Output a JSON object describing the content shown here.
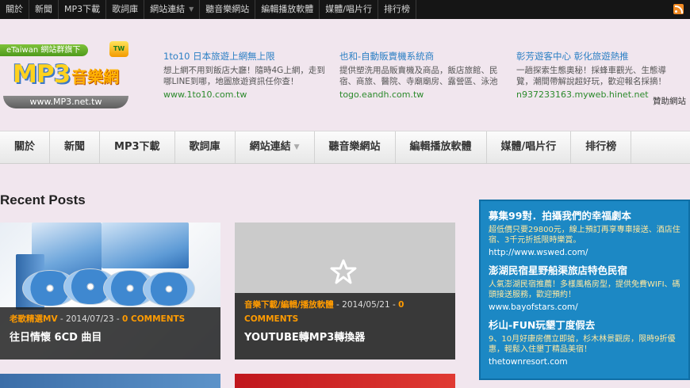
{
  "topnav": {
    "items": [
      "關於",
      "新聞",
      "MP3下載",
      "歌詞庫",
      "網站連結",
      "聽音樂網站",
      "編輯播放軟體",
      "媒體/唱片行",
      "排行榜"
    ]
  },
  "logo": {
    "tagline": "eTaiwan 網站群旗下",
    "badge": "TW",
    "mp3": "MP3",
    "name": "音樂網",
    "url": "www.MP3.net.tw"
  },
  "header_ads": [
    {
      "title": "1to10 日本旅遊上網無上限",
      "desc": "想上網不用到飯店大廳！隨時4G上網，走到哪LINE到哪，地圖旅遊資訊任你查！",
      "url": "www.1to10.com.tw"
    },
    {
      "title": "也和-自動販賣機系統商",
      "desc": "提供塑洗用品販賣機及商品，飯店旅館、民宿、商旅、醫院、寺廟廟房、露營區、泳池",
      "url": "togo.eandh.com.tw"
    },
    {
      "title": "彰芳遊客中心 彰化旅遊熱推",
      "desc": "一趟探索生態奧秘！採蜂車觀光、生態導覽，潮間帶解說超好玩，歡迎報名採摘！",
      "url": "n937233163.myweb.hinet.net"
    }
  ],
  "sponsor_label": "贊助網站",
  "mainnav": {
    "items": [
      "關於",
      "新聞",
      "MP3下載",
      "歌詞庫",
      "網站連結",
      "聽音樂網站",
      "編輯播放軟體",
      "媒體/唱片行",
      "排行榜"
    ]
  },
  "section_title": "Recent Posts",
  "posts": [
    {
      "category": "老歌精選MV",
      "date": " - 2014/07/23 - ",
      "comments": "0 COMMENTS",
      "title": "往日情懷 6CD 曲目"
    },
    {
      "category": "音樂下載/編輯/播放軟體",
      "date": " - 2014/05/21 - ",
      "comments_prefix": "0",
      "comments": "COMMENTS",
      "title": "YOUTUBE轉MP3轉換器"
    }
  ],
  "side_ads": [
    {
      "title": "募集99對．拍攝我們的幸福劇本",
      "desc": "超低價只要29800元，線上預訂再享專車接送、酒店住宿、3千元折抵限時樂賞。",
      "url": "http://www.wswed.com/"
    },
    {
      "title": "澎湖民宿星野船渠旅店特色民宿",
      "desc": "人氣澎湖民宿推薦！多樣風格房型，提供免費WIFI、碼頭接送服務，歡迎預約！",
      "url": "www.bayofstars.com/"
    },
    {
      "title": "杉山-FUN玩墾丁度假去",
      "desc": "9、10月好康房價立即搶，杉木林景觀房，限時9折優惠，輕鬆入住墾丁精品美宿！",
      "url": "thetownresort.com"
    }
  ],
  "colors": {
    "topbar": "#151515",
    "ad_title": "#2b7fc4",
    "ad_url": "#2c8a2c",
    "accent_orange": "#ff9b00",
    "side_ad_bg": "#1c88c4"
  }
}
